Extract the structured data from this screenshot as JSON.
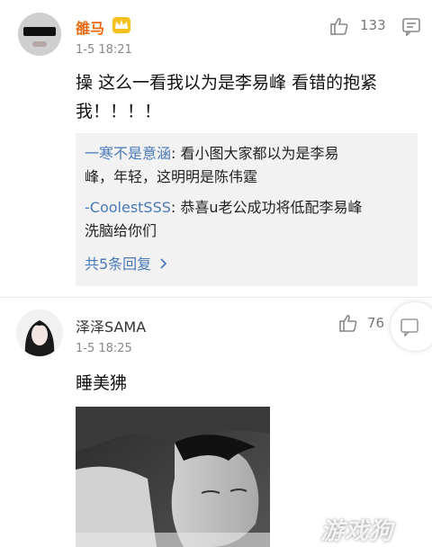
{
  "comments": [
    {
      "username": "雒马",
      "badge_icon": "crown-badge-icon",
      "time": "1-5 18:21",
      "likes": "133",
      "content_lines": [
        "操 这么一看我以为是李易峰 看错的抱紧",
        "我！！！！"
      ],
      "replies": [
        {
          "user": "一寒不是意涵",
          "line1": ": 看小图大家都以为是李易",
          "line2": "峰，年轻，这明明是陈伟霆"
        },
        {
          "user": "-CoolestSSS",
          "line1": ": 恭喜u老公成功将低配李易峰",
          "line2": "洗脑给你们"
        }
      ],
      "more_replies": "共5条回复"
    },
    {
      "username": "泽泽SAMA",
      "time": "1-5 18:25",
      "likes": "76",
      "content": "睡美狒"
    }
  ],
  "watermark": "游戏狗",
  "colors": {
    "accent_blue": "#4a7ab8",
    "vip_orange": "#e86a10",
    "reply_bg": "#f2f2f2"
  }
}
